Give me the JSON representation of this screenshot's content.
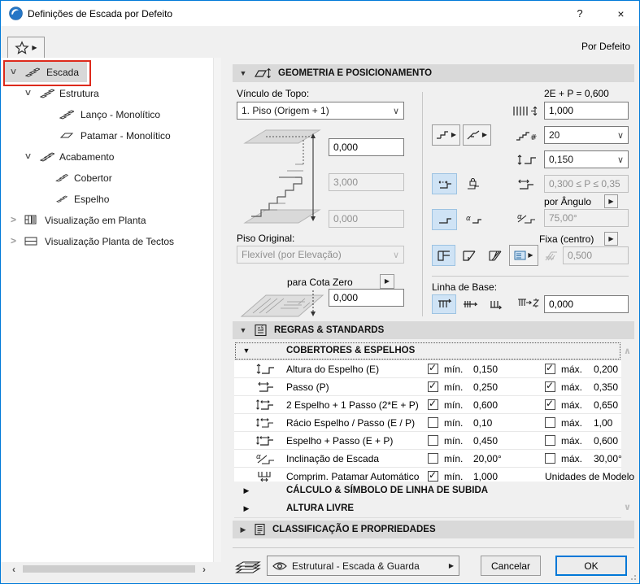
{
  "window": {
    "title": "Definições de Escada por Defeito",
    "help_label": "?",
    "close_label": "×"
  },
  "toolbar": {
    "default_label": "Por Defeito"
  },
  "tree": {
    "items": [
      {
        "label": "Escada"
      },
      {
        "label": "Estrutura"
      },
      {
        "label": "Lanço - Monolítico"
      },
      {
        "label": "Patamar - Monolítico"
      },
      {
        "label": "Acabamento"
      },
      {
        "label": "Cobertor"
      },
      {
        "label": "Espelho"
      },
      {
        "label": "Visualização em Planta"
      },
      {
        "label": "Visualização Planta de Tectos"
      }
    ]
  },
  "geometry": {
    "header": "GEOMETRIA E POSICIONAMENTO",
    "top_link_label": "Vínculo de Topo:",
    "top_link_value": "1. Piso (Origem + 1)",
    "offset_top_value": "0,000",
    "total_height_value": "3,000",
    "offset_bottom_value": "0,000",
    "original_story_label": "Piso Original:",
    "original_story_value": "Flexível (por Elevação)",
    "to_zero_label": "para Cota Zero",
    "to_zero_value": "0,000",
    "formula_label": "2E + P = 0,600",
    "width_value": "1,000",
    "riser_count_value": "20",
    "riser_height_value": "0,150",
    "going_range_value": "0,300 ≤ P ≤ 0,35",
    "by_angle_label": "por Ângulo",
    "angle_value": "75,00°",
    "fixed_center_label": "Fixa (centro)",
    "winder_value": "0,500",
    "baseline_label": "Linha de Base:",
    "baseline_offset_value": "0,000"
  },
  "rules": {
    "header": "REGRAS & STANDARDS",
    "tread_riser_header": "COBERTORES & ESPELHOS",
    "min_label": "mín.",
    "max_label": "máx.",
    "rows": [
      {
        "label": "Altura do Espelho (E)",
        "min_checked": true,
        "min_value": "0,150",
        "max_checked": true,
        "max_value": "0,200"
      },
      {
        "label": "Passo (P)",
        "min_checked": true,
        "min_value": "0,250",
        "max_checked": true,
        "max_value": "0,350"
      },
      {
        "label": "2 Espelho + 1 Passo (2*E + P)",
        "min_checked": true,
        "min_value": "0,600",
        "max_checked": true,
        "max_value": "0,650"
      },
      {
        "label": "Rácio Espelho / Passo (E / P)",
        "min_checked": false,
        "min_value": "0,10",
        "max_checked": false,
        "max_value": "1,00"
      },
      {
        "label": "Espelho + Passo (E + P)",
        "min_checked": false,
        "min_value": "0,450",
        "max_checked": false,
        "max_value": "0,600"
      },
      {
        "label": "Inclinação de Escada",
        "min_checked": false,
        "min_value": "20,00°",
        "max_checked": false,
        "max_value": "30,00°"
      },
      {
        "label": "Comprim. Patamar Automático",
        "min_checked": true,
        "min_value": "1,000",
        "units_label": "Unidades de Modelo"
      }
    ],
    "calc_header": "CÁLCULO & SÍMBOLO DE LINHA DE SUBIDA",
    "headroom_header": "ALTURA LIVRE"
  },
  "classification": {
    "header": "CLASSIFICAÇÃO E PROPRIEDADES"
  },
  "footer": {
    "layer_value": "Estrutural - Escada & Guarda",
    "cancel_label": "Cancelar",
    "ok_label": "OK"
  },
  "colors": {
    "accent": "#0079d8",
    "selection_blue": "#cfe3f5",
    "annotation_red": "#dd2a1c",
    "section_header_gray": "#d9d9d9"
  }
}
